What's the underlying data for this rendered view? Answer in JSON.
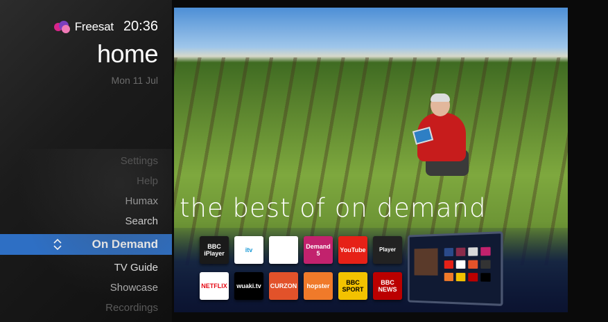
{
  "header": {
    "brand": "Freesat",
    "time": "20:36",
    "title": "home",
    "date": "Mon 11 Jul"
  },
  "menu": {
    "items": [
      {
        "label": "Settings"
      },
      {
        "label": "Help"
      },
      {
        "label": "Humax"
      },
      {
        "label": "Search"
      },
      {
        "label": "On Demand"
      },
      {
        "label": "TV Guide"
      },
      {
        "label": "Showcase"
      },
      {
        "label": "Recordings"
      }
    ]
  },
  "hero": {
    "tagline": "the best of on demand"
  },
  "apps": {
    "bbc_iplayer": "BBC iPlayer",
    "itv": "itv",
    "demand5": "Demand 5",
    "youtube": "YouTube",
    "player": "Player",
    "netflix": "NETFLIX",
    "wuaki": "wuaki.tv",
    "curzon": "CURZON",
    "hopster": "hopster",
    "bbc_sport": "BBC SPORT",
    "bbc_news": "BBC NEWS"
  },
  "colors": {
    "accent": "#2e6fc4",
    "sidebar_bg": "#1b1b1b"
  }
}
